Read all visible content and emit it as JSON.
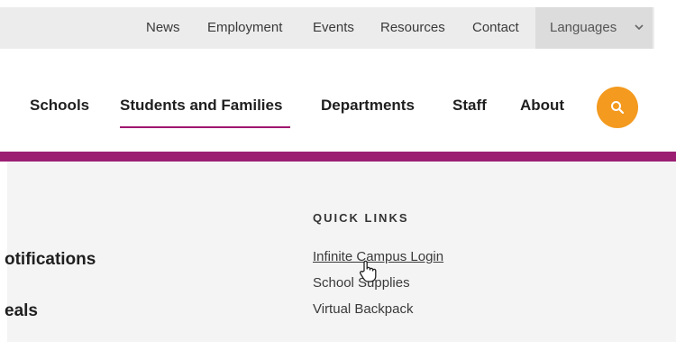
{
  "utility_nav": {
    "links": [
      "News",
      "Employment",
      "Events",
      "Resources",
      "Contact"
    ],
    "language_label": "Languages",
    "language_icon": "chevron-down-icon"
  },
  "main_nav": {
    "items": [
      "Schools",
      "Students and Families",
      "Departments",
      "Staff",
      "About"
    ],
    "active_item": "Students and Families",
    "search_icon": "search-icon"
  },
  "colors": {
    "accent": "#9b1e73",
    "search_button": "#f39a1f",
    "utility_bg": "#ececec",
    "dropdown_bg": "#f4f4f4"
  },
  "dropdown": {
    "left_headings": [
      "otifications",
      "eals"
    ],
    "quick_links": {
      "title": "QUICK LINKS",
      "links": [
        "Infinite Campus Login",
        "School Supplies",
        "Virtual Backpack"
      ]
    }
  }
}
